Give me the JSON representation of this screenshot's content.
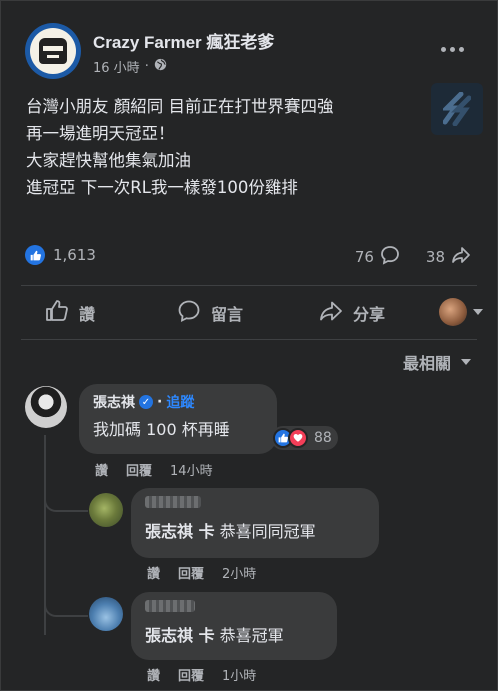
{
  "post": {
    "page_name": "Crazy Farmer 瘋狂老爹",
    "time": "16 小時",
    "separator": "·",
    "lines": [
      "台灣小朋友 顏紹同 目前正在打世界賽四強",
      "再一場進明天冠亞！",
      "大家趕快幫他集氣加油",
      "進冠亞 下一次RL我一樣發100份雞排"
    ]
  },
  "stats": {
    "likes": "1,613",
    "comments": "76",
    "shares": "38"
  },
  "actions": {
    "like": "讚",
    "comment": "留言",
    "share": "分享"
  },
  "sort_label": "最相關",
  "comments": [
    {
      "name": "張志祺",
      "follow": "追蹤",
      "text": "我加碼 100 杯再睡",
      "reaction_count": "88",
      "like": "讚",
      "reply": "回覆",
      "time": "14小時"
    },
    {
      "mention": "張志祺 卡",
      "text": "恭喜同同冠軍",
      "like": "讚",
      "reply": "回覆",
      "time": "2小時"
    },
    {
      "mention": "張志祺 卡",
      "text": "恭喜冠軍",
      "like": "讚",
      "reply": "回覆",
      "time": "1小時"
    }
  ],
  "icons": [
    "globe-icon",
    "more-icon",
    "like-icon",
    "comment-icon",
    "share-icon",
    "verified-icon",
    "love-icon",
    "chevron-down-icon"
  ],
  "colors": {
    "accent": "#2374e1",
    "link": "#2d88ff",
    "love": "#f33e58",
    "background": "#242526"
  }
}
